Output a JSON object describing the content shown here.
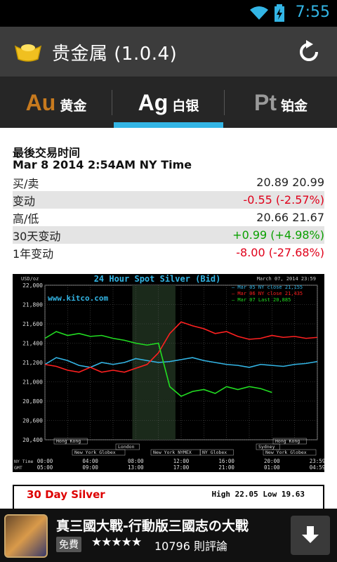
{
  "status_bar": {
    "time": "7:55",
    "wifi_icon": "wifi-icon",
    "battery_icon": "battery-charging-icon"
  },
  "action_bar": {
    "title": "贵金属   (1.0.4)",
    "app_icon": "gold-ingot-icon",
    "refresh_icon": "refresh-icon"
  },
  "tabs": [
    {
      "symbol": "Au",
      "label": "黄金",
      "symbol_color": "#c77a1e",
      "active": false
    },
    {
      "symbol": "Ag",
      "label": "白银",
      "symbol_color": "#ffffff",
      "active": true
    },
    {
      "symbol": "Pt",
      "label": "铂金",
      "symbol_color": "#9a9a9a",
      "active": false
    }
  ],
  "quote": {
    "last_trade_label": "最後交易时间",
    "last_trade_time": "Mar  8 2014  2:54AM NY Time",
    "rows": [
      {
        "label": "买/卖",
        "value": "20.89 20.99",
        "tone": "normal"
      },
      {
        "label": "变动",
        "value": "-0.55 (-2.57%)",
        "tone": "neg"
      },
      {
        "label": "高/低",
        "value": "20.66 21.67",
        "tone": "normal"
      },
      {
        "label": "30天变动",
        "value": "+0.99 (+4.98%)",
        "tone": "pos"
      },
      {
        "label": "1年变动",
        "value": "-8.00 (-27.68%)",
        "tone": "neg"
      }
    ]
  },
  "chart_data": {
    "type": "line",
    "title": "24 Hour Spot Silver (Bid)",
    "unit_label": "USD/oz",
    "date_label": "March 07, 2014 23:59",
    "watermark": "www.kitco.com",
    "ylim": [
      20.4,
      22.0
    ],
    "yticks": [
      "22,000",
      "21,800",
      "21,600",
      "21,400",
      "21,200",
      "21,000",
      "20,800",
      "20,600",
      "20,400"
    ],
    "xticks_ny": [
      "00:00",
      "04:00",
      "08:00",
      "12:00",
      "16:00",
      "20:00",
      "23:59"
    ],
    "xticks_gmt": [
      "05:00",
      "09:00",
      "13:00",
      "17:00",
      "21:00",
      "01:00",
      "04:59"
    ],
    "x_row_labels": [
      "NY Time",
      "GMT"
    ],
    "market_labels": [
      "Hong Kong",
      "London",
      "New York Globex",
      "New York NYMEX",
      "NY Globex",
      "Sydney",
      "Hong Kong",
      "New York Globex"
    ],
    "legend": [
      {
        "text": "Mar 05 NY close 21,155",
        "color": "#33b5e5"
      },
      {
        "text": "Mar 06 NY close 21,435",
        "color": "#ff2020"
      },
      {
        "text": "Mar 07 Last 20,885",
        "color": "#22dd22"
      }
    ],
    "series": [
      {
        "name": "Mar 05",
        "color": "#33b5e5",
        "x": [
          0,
          1,
          2,
          3,
          4,
          5,
          6,
          7,
          8,
          9,
          10,
          11,
          12,
          13,
          14,
          15,
          16,
          17,
          18,
          19,
          20,
          21,
          22,
          23,
          24
        ],
        "y": [
          21.18,
          21.25,
          21.22,
          21.17,
          21.15,
          21.2,
          21.18,
          21.2,
          21.24,
          21.22,
          21.2,
          21.21,
          21.23,
          21.25,
          21.22,
          21.2,
          21.18,
          21.17,
          21.15,
          21.18,
          21.17,
          21.16,
          21.18,
          21.19,
          21.21
        ]
      },
      {
        "name": "Mar 06",
        "color": "#ff2020",
        "x": [
          0,
          1,
          2,
          3,
          4,
          5,
          6,
          7,
          8,
          9,
          10,
          11,
          12,
          13,
          14,
          15,
          16,
          17,
          18,
          19,
          20,
          21,
          22,
          23,
          24
        ],
        "y": [
          21.18,
          21.16,
          21.12,
          21.1,
          21.15,
          21.1,
          21.12,
          21.1,
          21.14,
          21.18,
          21.3,
          21.5,
          21.62,
          21.58,
          21.55,
          21.5,
          21.52,
          21.47,
          21.44,
          21.45,
          21.48,
          21.46,
          21.47,
          21.45,
          21.46
        ]
      },
      {
        "name": "Mar 07",
        "color": "#22dd22",
        "x": [
          0,
          1,
          2,
          3,
          4,
          5,
          6,
          7,
          8,
          9,
          10,
          11,
          12,
          13,
          14,
          15,
          16,
          17,
          18,
          19,
          20
        ],
        "y": [
          21.45,
          21.52,
          21.48,
          21.5,
          21.47,
          21.48,
          21.45,
          21.43,
          21.4,
          21.38,
          21.4,
          20.95,
          20.85,
          20.9,
          20.92,
          20.88,
          20.95,
          20.92,
          20.95,
          20.93,
          20.89
        ]
      }
    ]
  },
  "month_card": {
    "title": "30 Day Silver",
    "high_low": "High 22.05 Low 19.63"
  },
  "ad": {
    "title": "真三國大戰-行動版三國志の大戰",
    "free_label": "免費",
    "stars": "★★★★★",
    "reviews": "10796 則評論",
    "download_icon": "download-arrow-icon"
  }
}
